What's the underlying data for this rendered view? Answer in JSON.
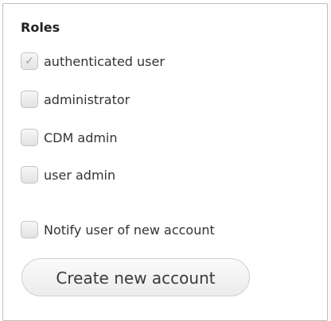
{
  "roles": {
    "heading": "Roles",
    "items": [
      {
        "label": "authenticated user",
        "checked": true,
        "disabled": true
      },
      {
        "label": "administrator",
        "checked": false
      },
      {
        "label": "CDM admin",
        "checked": false
      },
      {
        "label": "user admin",
        "checked": false
      }
    ]
  },
  "notify": {
    "label": "Notify user of new account",
    "checked": false
  },
  "submit": {
    "label": "Create new account"
  },
  "colors": {
    "border": "#bfbfbf",
    "text": "#333333",
    "checkbox_bg": "#eeeeee"
  }
}
